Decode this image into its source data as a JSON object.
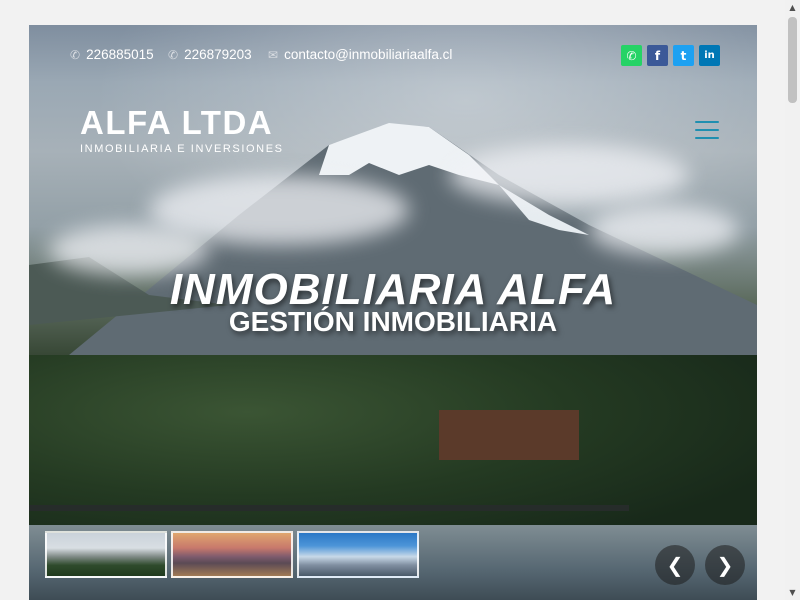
{
  "contact": {
    "phone1": "226885015",
    "phone2": "226879203",
    "email": "contacto@inmobiliariaalfa.cl",
    "phone_icon": "phone-icon",
    "email_icon": "envelope-icon"
  },
  "socials": [
    {
      "name": "whatsapp",
      "glyph": "✆",
      "color": "#25d366"
    },
    {
      "name": "facebook",
      "glyph": "f",
      "color": "#3b5998"
    },
    {
      "name": "twitter",
      "glyph": "t",
      "color": "#1da1f2"
    },
    {
      "name": "linkedin",
      "glyph": "in",
      "color": "#0077b5"
    }
  ],
  "logo": {
    "main": "ALFA LTDA",
    "sub": "INMOBILIARIA E INVERSIONES"
  },
  "hero": {
    "title": "INMOBILIARIA ALFA",
    "subtitle": "GESTIÓN INMOBILIARIA"
  },
  "slider": {
    "prev_glyph": "❮",
    "next_glyph": "❯"
  },
  "colors": {
    "menu_accent": "#1f8fb0"
  }
}
